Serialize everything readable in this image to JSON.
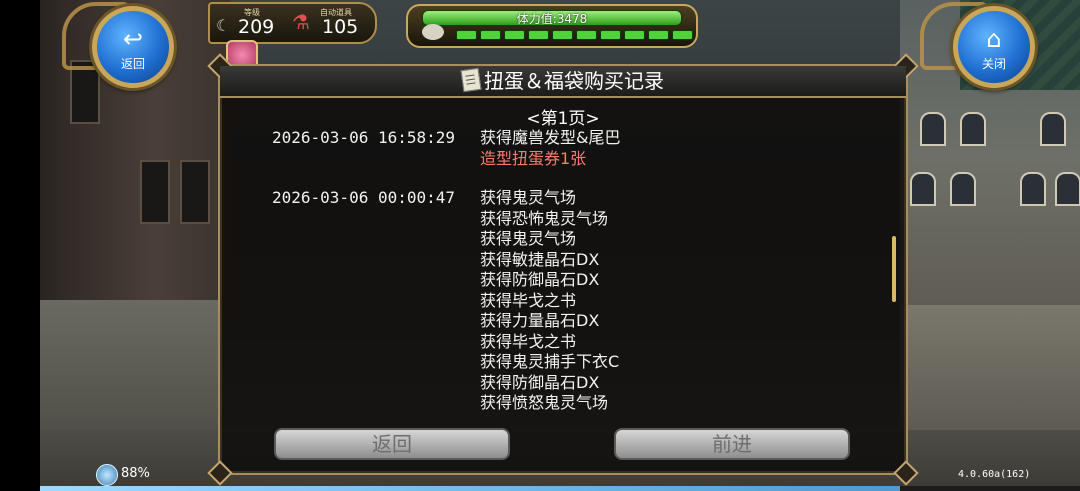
{
  "hud": {
    "back_label": "返回",
    "close_label": "关闭",
    "level_label": "等级",
    "level_value": "209",
    "auto_item_label": "自动道具",
    "auto_item_value": "105",
    "stamina_text": "体力值:3478"
  },
  "dialog": {
    "title": "扭蛋＆福袋购买记录",
    "page_label": "<第1页>",
    "records": [
      {
        "date": "2026-03-06 16:58:29",
        "items": [
          {
            "text": "获得魔兽发型&尾巴",
            "highlight": false
          },
          {
            "text": "造型扭蛋券1张",
            "highlight": true
          }
        ]
      },
      {
        "date": "2026-03-06 00:00:47",
        "items": [
          {
            "text": "获得鬼灵气场",
            "highlight": false
          },
          {
            "text": "获得恐怖鬼灵气场",
            "highlight": false
          },
          {
            "text": "获得鬼灵气场",
            "highlight": false
          },
          {
            "text": "获得敏捷晶石DX",
            "highlight": false
          },
          {
            "text": "获得防御晶石DX",
            "highlight": false
          },
          {
            "text": "获得毕戈之书",
            "highlight": false
          },
          {
            "text": "获得力量晶石DX",
            "highlight": false
          },
          {
            "text": "获得毕戈之书",
            "highlight": false
          },
          {
            "text": "获得鬼灵捕手下衣C",
            "highlight": false
          },
          {
            "text": "获得防御晶石DX",
            "highlight": false
          },
          {
            "text": "获得愤怒鬼灵气场",
            "highlight": false
          }
        ]
      }
    ],
    "back_button": "返回",
    "forward_button": "前进"
  },
  "status": {
    "network_text": "88%",
    "version": "4.0.60a(162)"
  },
  "colors": {
    "highlight": "#ff7a6e",
    "gold_frame": "#a78e5e",
    "hp_green": "#4fd23a"
  },
  "icons": [
    "back-arrow-icon",
    "home-icon",
    "level-icon",
    "potion-icon",
    "gift-icon",
    "document-icon",
    "network-icon"
  ]
}
